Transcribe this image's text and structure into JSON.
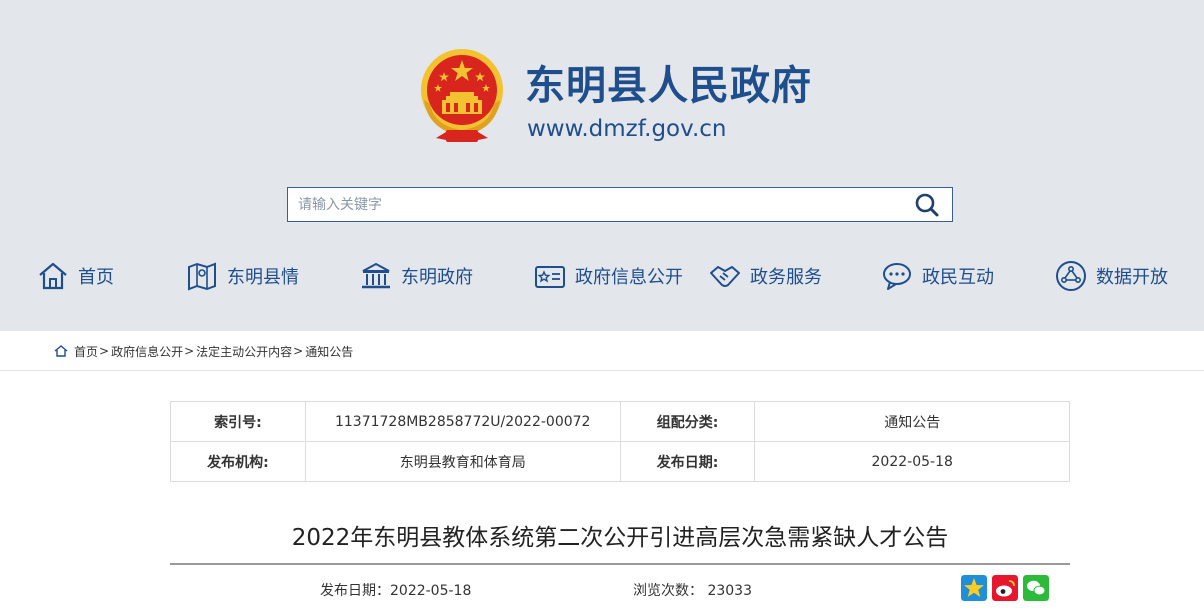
{
  "site": {
    "title": "东明县人民政府",
    "url": "www.dmzf.gov.cn"
  },
  "search": {
    "placeholder": "请输入关键字",
    "value": "",
    "button_icon": "search-icon"
  },
  "nav": {
    "items": [
      {
        "label": "首页",
        "icon": "home-icon"
      },
      {
        "label": "东明县情",
        "icon": "map-icon"
      },
      {
        "label": "东明政府",
        "icon": "government-building-icon"
      },
      {
        "label": "政府信息公开",
        "icon": "id-card-icon"
      },
      {
        "label": "政务服务",
        "icon": "handshake-icon"
      },
      {
        "label": "政民互动",
        "icon": "chat-icon"
      },
      {
        "label": "数据开放",
        "icon": "network-icon"
      }
    ]
  },
  "breadcrumb": {
    "items": [
      "首页",
      "政府信息公开",
      "法定主动公开内容",
      "通知公告"
    ],
    "separator": ">"
  },
  "meta": {
    "index_label": "索引号:",
    "index_value": "11371728MB2858772U/2022-00072",
    "category_label": "组配分类:",
    "category_value": "通知公告",
    "org_label": "发布机构:",
    "org_value": "东明县教育和体育局",
    "date_label": "发布日期:",
    "date_value": "2022-05-18"
  },
  "article": {
    "title": "2022年东明县教体系统第二次公开引进高层次急需紧缺人才公告",
    "publish_date_text": "发布日期：2022-05-18",
    "views_text": "浏览次数： 23033"
  },
  "share": [
    "qzone-icon",
    "weibo-icon",
    "wechat-icon"
  ],
  "colors": {
    "header_bg": "#e3e6eb",
    "brand_blue": "#1f4e8c",
    "emblem_red": "#d8251d",
    "emblem_gold": "#f2c230"
  }
}
